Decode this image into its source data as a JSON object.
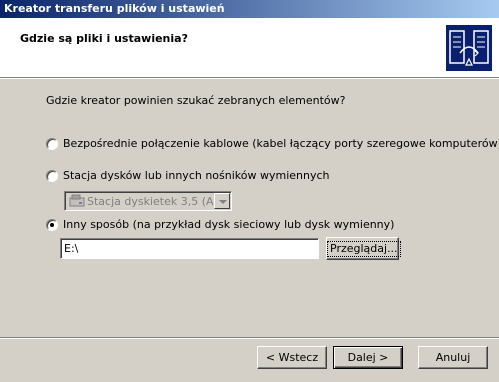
{
  "window": {
    "title": "Kreator transferu plików i ustawień"
  },
  "header": {
    "title": "Gdzie są pliki i ustawienia?",
    "logo_icon": "transfer-wizard-icon"
  },
  "content": {
    "question": "Gdzie kreator powinien szukać zebranych elementów?",
    "options": [
      {
        "label": "Bezpośrednie połączenie kablowe (kabel łączący porty szeregowe komputerów)",
        "selected": false,
        "enabled": true
      },
      {
        "label": "Stacja dysków lub innych nośników wymiennych",
        "selected": false,
        "enabled": true
      },
      {
        "label": "Inny sposób (na przykład dysk sieciowy lub dysk wymienny)",
        "selected": true,
        "enabled": true
      }
    ],
    "drive_select": {
      "value": "Stacja dyskietek 3,5 (A:)",
      "enabled": false,
      "icon": "floppy-drive-icon"
    },
    "path_input": {
      "value": "E:\\"
    },
    "browse_label": "Przeglądaj..."
  },
  "footer": {
    "back_label": "< Wstecz",
    "next_label": "Dalej >",
    "cancel_label": "Anuluj"
  }
}
